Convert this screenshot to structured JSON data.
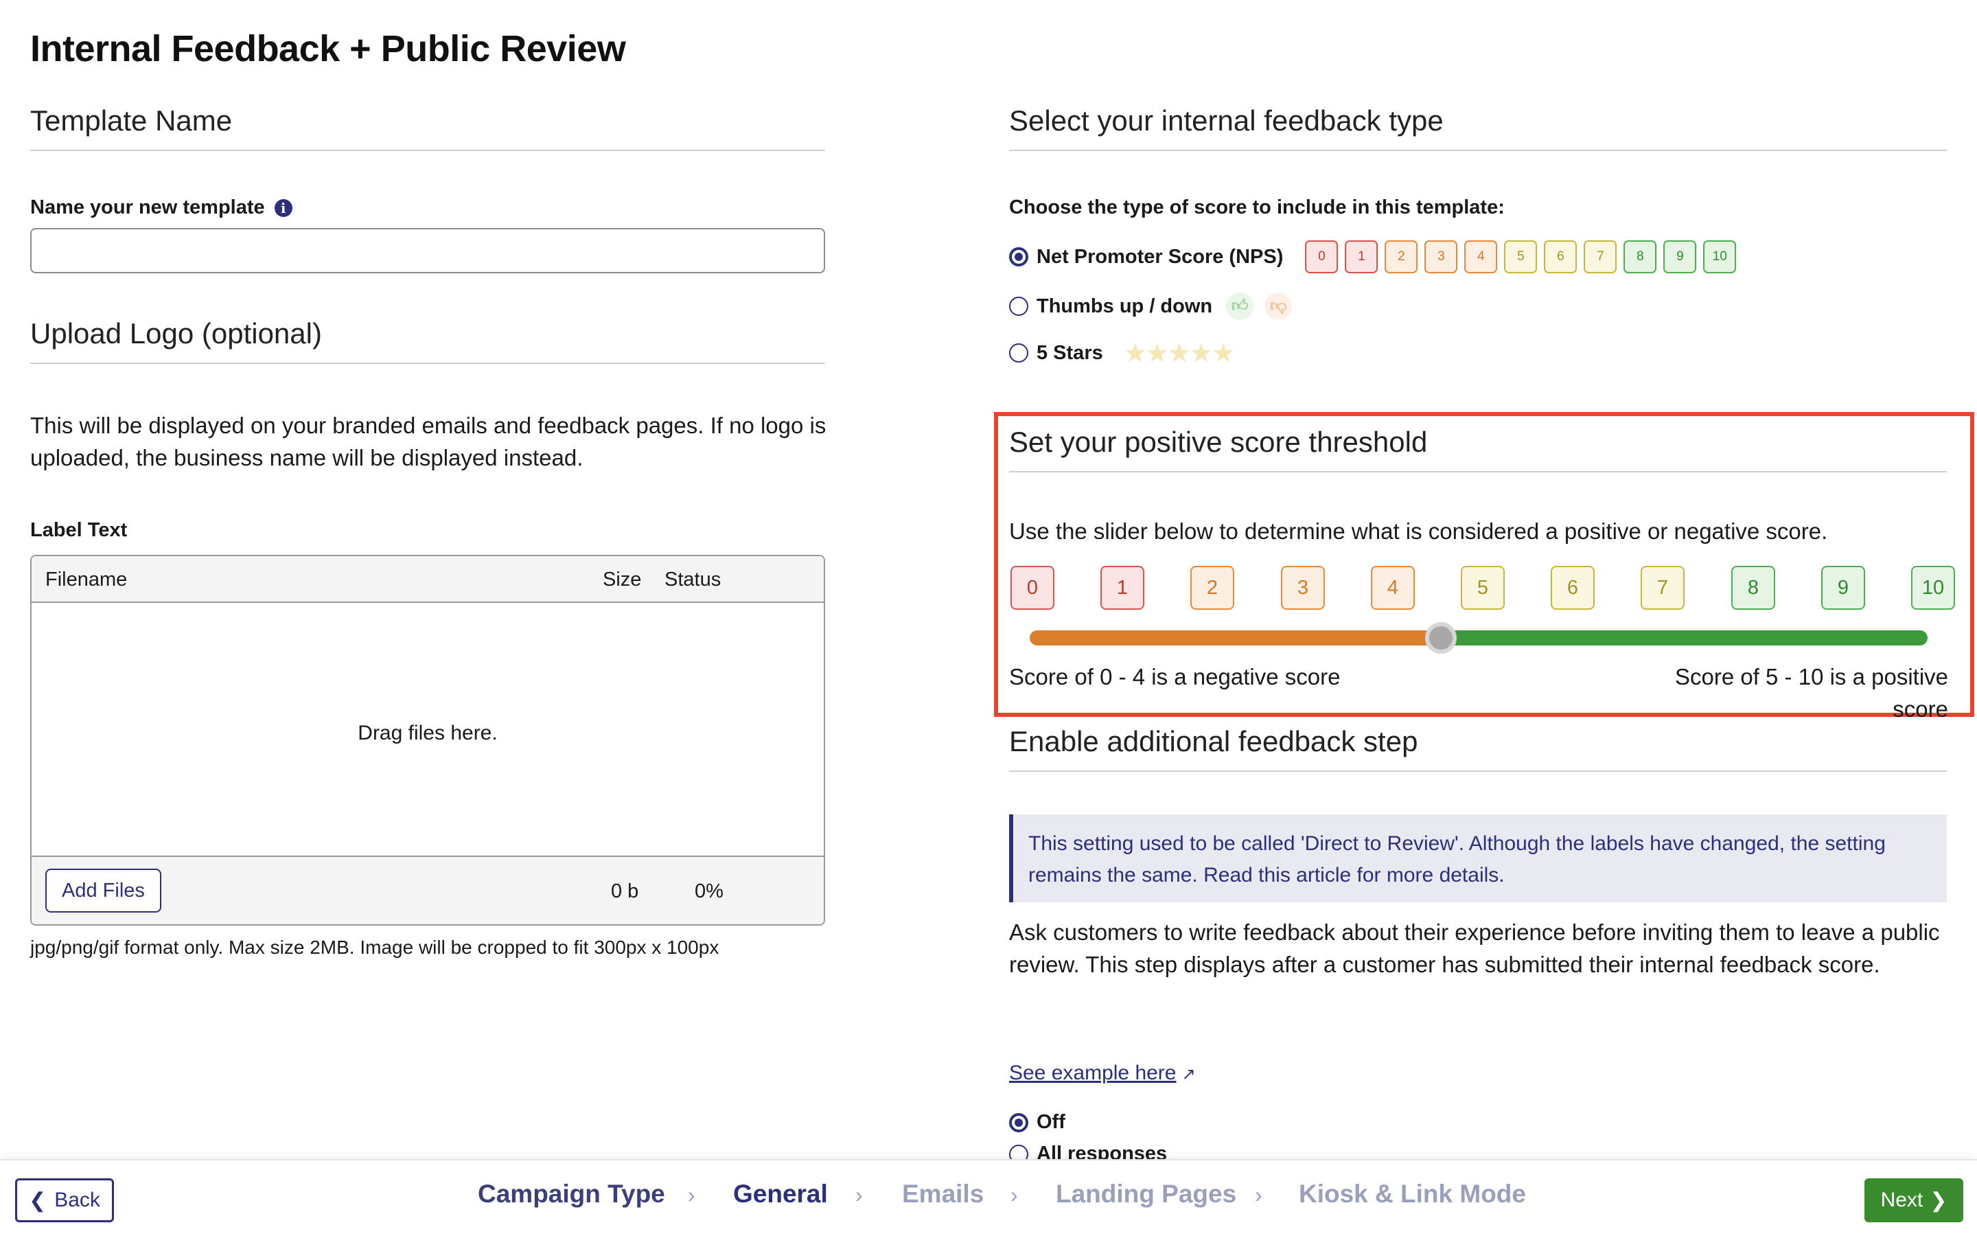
{
  "page_title": "Internal Feedback + Public Review",
  "left": {
    "template_name_heading": "Template Name",
    "name_label": "Name your new template",
    "name_input_value": "",
    "name_input_placeholder": "",
    "upload_heading": "Upload Logo (optional)",
    "upload_description": "This will be displayed on your branded emails and feedback pages. If no logo is uploaded, the business name will be displayed instead.",
    "label_text": "Label Text",
    "uploader": {
      "col_filename": "Filename",
      "col_size": "Size",
      "col_status": "Status",
      "drop_text": "Drag files here.",
      "add_files_label": "Add Files",
      "total_size": "0 b",
      "total_progress": "0%"
    },
    "format_hint": "jpg/png/gif format only. Max size 2MB. Image will be cropped to fit 300px x 100px"
  },
  "right": {
    "feedback_type_heading": "Select your internal feedback type",
    "choose_label": "Choose the type of score to include in this template:",
    "options": [
      {
        "label": "Net Promoter Score (NPS)",
        "selected": true
      },
      {
        "label": "Thumbs up / down",
        "selected": false
      },
      {
        "label": "5 Stars",
        "selected": false
      }
    ],
    "nps_values": [
      "0",
      "1",
      "2",
      "3",
      "4",
      "5",
      "6",
      "7",
      "8",
      "9",
      "10"
    ],
    "threshold": {
      "heading": "Set your positive score threshold",
      "instruction": "Use the slider below to determine what is considered a positive or negative score.",
      "threshold_value": 5,
      "negative_text": "Score of 0 - 4 is a negative score",
      "positive_text": "Score of 5 - 10 is a positive score"
    },
    "additional_step": {
      "heading": "Enable additional feedback step",
      "callout": "This setting used to be called 'Direct to Review'. Although the labels have changed, the setting remains the same. Read this article for more details.",
      "description": "Ask customers to write feedback about their experience before inviting them to leave a public review. This step displays after a customer has submitted their internal feedback score.",
      "example_link": "See example here",
      "options": [
        {
          "label": "Off",
          "selected": true
        },
        {
          "label": "All responses",
          "selected": false
        }
      ]
    }
  },
  "footer": {
    "back_label": "Back",
    "next_label": "Next",
    "steps": [
      {
        "label": "Campaign Type",
        "state": "done"
      },
      {
        "label": "General",
        "state": "current"
      },
      {
        "label": "Emails",
        "state": "todo"
      },
      {
        "label": "Landing Pages",
        "state": "todo"
      },
      {
        "label": "Kiosk & Link Mode",
        "state": "todo"
      }
    ]
  },
  "colors": {
    "brand_navy": "#2c2f7a",
    "negative_orange": "#dc7f2c",
    "positive_green": "#3c9a3a",
    "highlight_red": "#e8432d",
    "next_green": "#3a8a2e"
  }
}
